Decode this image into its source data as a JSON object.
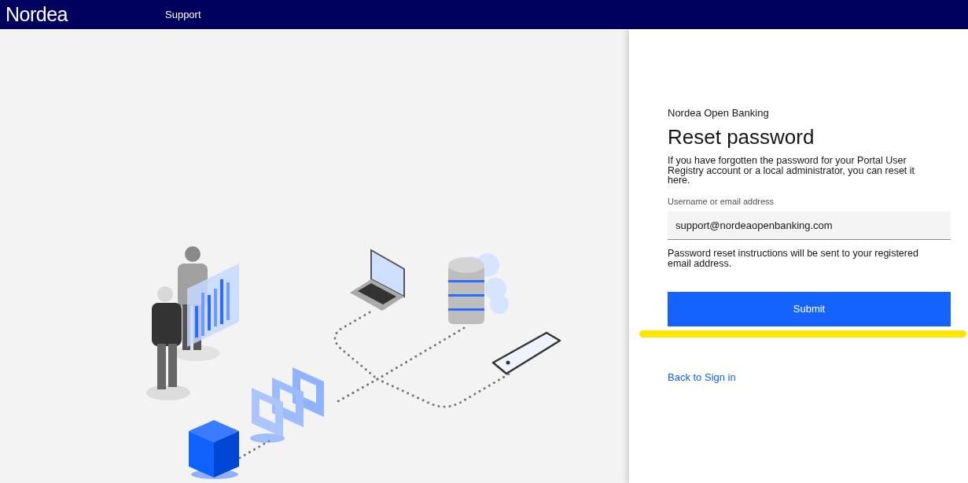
{
  "header": {
    "logo": "Nordea",
    "nav": [
      {
        "label": "Support"
      }
    ]
  },
  "form": {
    "eyebrow": "Nordea Open Banking",
    "title": "Reset password",
    "description": "If you have forgotten the password for your Portal User Registry account or a local administrator, you can reset it here.",
    "field": {
      "label": "Username or email address",
      "value": "support@nordeaopenbanking.com"
    },
    "helper": "Password reset instructions will be sent to your registered email address.",
    "submit": "Submit",
    "back_link": "Back to Sign in"
  }
}
